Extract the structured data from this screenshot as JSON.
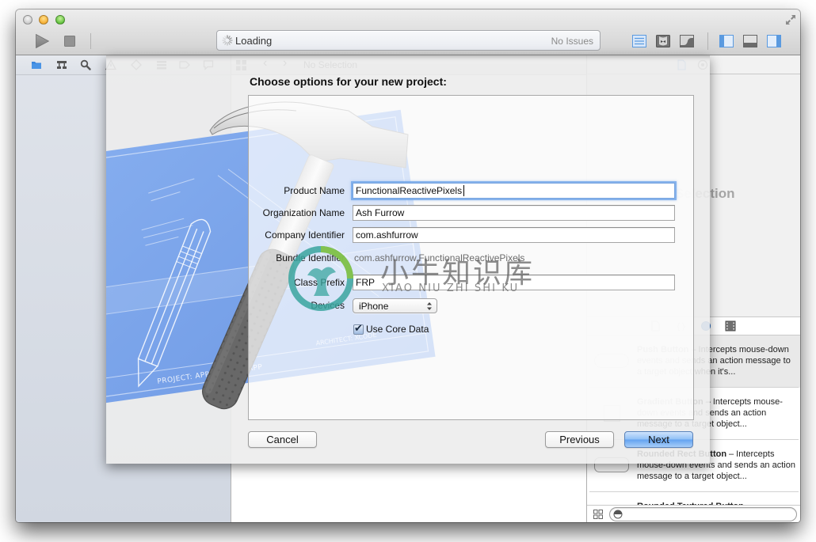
{
  "colors": {
    "accent": "#3d8ee6",
    "close_light": "#c9c9c9",
    "minimize_light": "#f5ab2e",
    "zoom_light": "#5bbf39",
    "navigator_bg": "#d7dce5",
    "next_top": "#cfe4fc",
    "next_bottom": "#62a2f0",
    "focus_ring": "#6fa4ea"
  },
  "window": {
    "traffic_lights": [
      "close",
      "minimize",
      "zoom"
    ]
  },
  "toolbar": {
    "run_icon": "play-icon",
    "stop_icon": "stop-icon",
    "activity": {
      "status": "Loading",
      "issues": "No Issues"
    },
    "editor_modes": [
      {
        "icon": "standard-editor-icon",
        "active": true
      },
      {
        "icon": "assistant-editor-icon",
        "active": false
      },
      {
        "icon": "version-editor-icon",
        "active": false
      }
    ],
    "view_toggles": [
      {
        "icon": "navigator-toggle-icon",
        "active": true
      },
      {
        "icon": "debug-area-toggle-icon",
        "active": false
      },
      {
        "icon": "utilities-toggle-icon",
        "active": true
      }
    ],
    "fullscreen_icon": "fullscreen-icon"
  },
  "navigator": {
    "tabs": [
      {
        "icon": "project-navigator-icon",
        "active": true
      },
      {
        "icon": "symbol-navigator-icon",
        "active": false
      },
      {
        "icon": "find-navigator-icon",
        "active": false
      },
      {
        "icon": "issue-navigator-icon",
        "active": false
      },
      {
        "icon": "test-navigator-icon",
        "active": false
      },
      {
        "icon": "debug-navigator-icon",
        "active": false
      },
      {
        "icon": "breakpoint-navigator-icon",
        "active": false
      },
      {
        "icon": "log-navigator-icon",
        "active": false
      }
    ]
  },
  "editor": {
    "jump_bar": {
      "back": "‹",
      "forward": "›",
      "title": "No Selection"
    }
  },
  "utilities": {
    "inspector_tabs": [
      {
        "icon": "file-inspector-icon",
        "active": true
      },
      {
        "icon": "quick-help-icon",
        "active": false
      }
    ],
    "inspector_empty_text": "No Selection",
    "library_tabs": [
      {
        "icon": "file-template-library-icon",
        "active": false
      },
      {
        "icon": "code-snippet-library-icon",
        "active": false
      },
      {
        "icon": "object-library-icon",
        "active": true
      },
      {
        "icon": "media-library-icon",
        "active": false
      }
    ],
    "library_separator": "–",
    "library_items": [
      {
        "title": "Push Button",
        "description": "Intercepts mouse-down events and sends an action message to a target object when it's..."
      },
      {
        "title": "Gradient Button",
        "description": "Intercepts mouse-down events and sends an action message to a target object..."
      },
      {
        "title": "Rounded Rect Button",
        "description": "Intercepts mouse-down events and sends an action message to a target object..."
      },
      {
        "title": "Rounded Textured Button",
        "description": ""
      }
    ],
    "filter": {
      "value": ""
    }
  },
  "sheet": {
    "title": "Choose options for your new project:",
    "fields": {
      "product_name": {
        "label": "Product Name",
        "value": "FunctionalReactivePixels"
      },
      "organization_name": {
        "label": "Organization Name",
        "value": "Ash Furrow"
      },
      "company_identifier": {
        "label": "Company Identifier",
        "value": "com.ashfurrow"
      },
      "bundle_identifier": {
        "label": "Bundle Identifier",
        "value": "com.ashfurrow.FunctionalReactivePixels"
      },
      "class_prefix": {
        "label": "Class Prefix",
        "value": "FRP"
      },
      "devices": {
        "label": "Devices",
        "value": "iPhone"
      },
      "use_core_data": {
        "label": "Use Core Data",
        "checked": true
      }
    },
    "buttons": {
      "cancel": "Cancel",
      "previous": "Previous",
      "next": "Next"
    },
    "illustration": {
      "project_text": "PROJECT: APPLICATION.APP",
      "architect_text": "ARCHITECT: XCODE"
    }
  },
  "watermark": {
    "title": "小牛知识库",
    "subtitle": "XIAO NIU ZHI SHI KU"
  }
}
